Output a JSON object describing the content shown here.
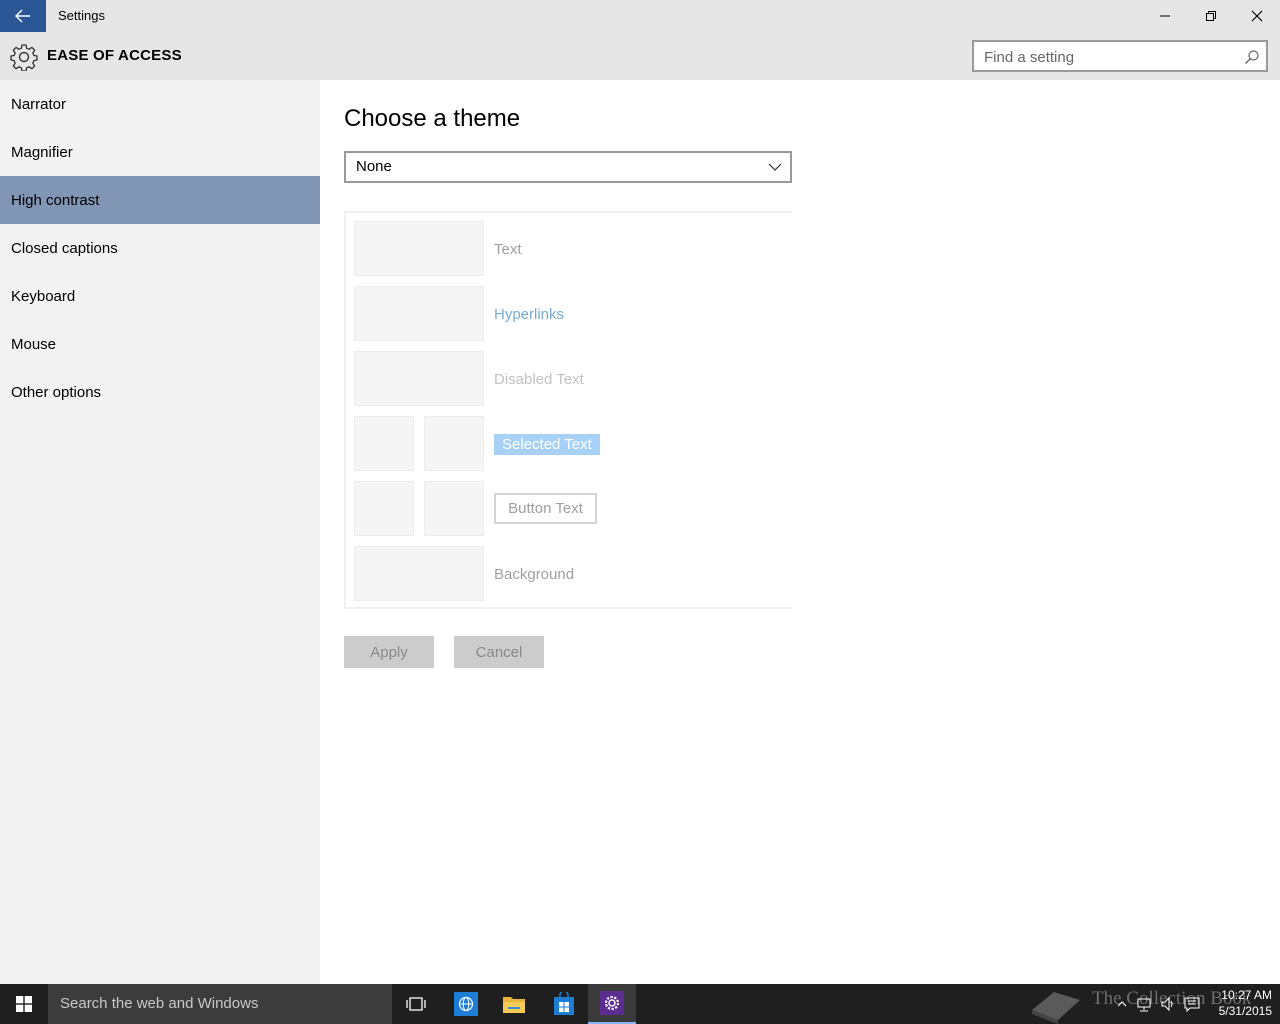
{
  "window": {
    "title": "Settings",
    "back_icon": "back-arrow-icon",
    "controls": [
      "minimize-icon",
      "restore-icon",
      "close-icon"
    ]
  },
  "header": {
    "section_title": "EASE OF ACCESS",
    "icon": "gear-icon",
    "search_placeholder": "Find a setting"
  },
  "sidebar": {
    "items": [
      {
        "label": "Narrator",
        "selected": false
      },
      {
        "label": "Magnifier",
        "selected": false
      },
      {
        "label": "High contrast",
        "selected": true
      },
      {
        "label": "Closed captions",
        "selected": false
      },
      {
        "label": "Keyboard",
        "selected": false
      },
      {
        "label": "Mouse",
        "selected": false
      },
      {
        "label": "Other options",
        "selected": false
      }
    ]
  },
  "main": {
    "title": "Choose a theme",
    "theme_select": {
      "value": "None"
    },
    "preview": {
      "text": "Text",
      "hyperlinks": "Hyperlinks",
      "disabled_text": "Disabled Text",
      "selected_text": "Selected Text",
      "button_text": "Button Text",
      "background": "Background"
    },
    "apply_label": "Apply",
    "cancel_label": "Cancel"
  },
  "taskbar": {
    "search_text": "Search the web and Windows",
    "watermark": "The Collection Book",
    "time": "10:27 AM",
    "date": "5/31/2015"
  },
  "colors": {
    "accent": "#2b5797",
    "sidebar_selected": "#8195b5",
    "sidebar_bg": "#f2f2f2",
    "header_bg": "#e6e6e6",
    "taskbar_bg": "#1f1f1f"
  }
}
